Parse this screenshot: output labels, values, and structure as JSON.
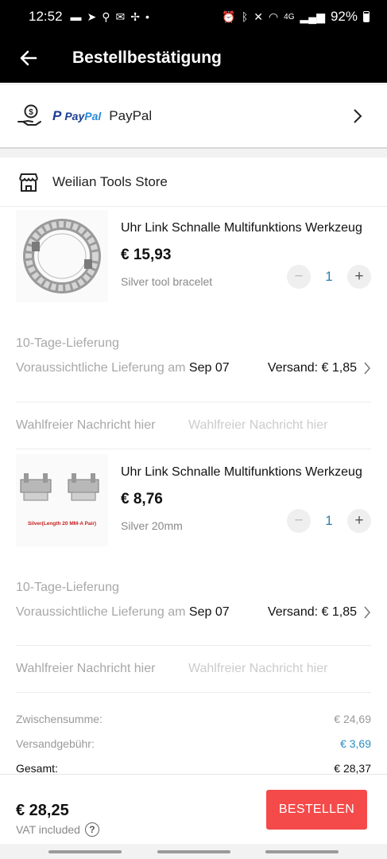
{
  "status": {
    "time": "12:52",
    "battery": "92%",
    "network": "4G"
  },
  "header": {
    "title": "Bestellbestätigung"
  },
  "payment": {
    "brand_mark": "P",
    "brand1": "Pay",
    "brand2": "Pal",
    "method": "PayPal"
  },
  "store": {
    "name": "Weilian Tools Store"
  },
  "products": [
    {
      "title": "Uhr Link Schnalle Multifunktions Werkzeug",
      "price": "€ 15,93",
      "variant": "Silver tool bracelet",
      "qty": "1",
      "delivery_type": "10-Tage-Lieferung",
      "delivery_prefix": "Voraussichtliche Lieferung am ",
      "delivery_date": "Sep 07",
      "shipping": "Versand: € 1,85",
      "msg_label": "Wahlfreier Nachricht hier",
      "msg_placeholder": "Wahlfreier Nachricht hier"
    },
    {
      "title": "Uhr Link Schnalle Multifunktions Werkzeug",
      "price": "€ 8,76",
      "variant": "Silver 20mm",
      "qty": "1",
      "image_caption": "Silver(Length 20 MM-A Pair)",
      "delivery_type": "10-Tage-Lieferung",
      "delivery_prefix": "Voraussichtliche Lieferung am ",
      "delivery_date": "Sep 07",
      "shipping": "Versand: € 1,85",
      "msg_label": "Wahlfreier Nachricht hier",
      "msg_placeholder": "Wahlfreier Nachricht hier"
    }
  ],
  "summary": {
    "subtotal_label": "Zwischensumme:",
    "subtotal": "€ 24,69",
    "shipping_label": "Versandgebühr:",
    "shipping": "€ 3,69",
    "total_label": "Gesamt:",
    "total": "€ 28,37"
  },
  "footer": {
    "total": "€ 28,25",
    "vat": "VAT included",
    "help": "?",
    "order_button": "BESTELLEN"
  },
  "colors": {
    "accent": "#f44a4a",
    "link_blue": "#2b8ec0",
    "paypal_dark": "#1b3f8f",
    "paypal_light": "#2a8ad8"
  }
}
